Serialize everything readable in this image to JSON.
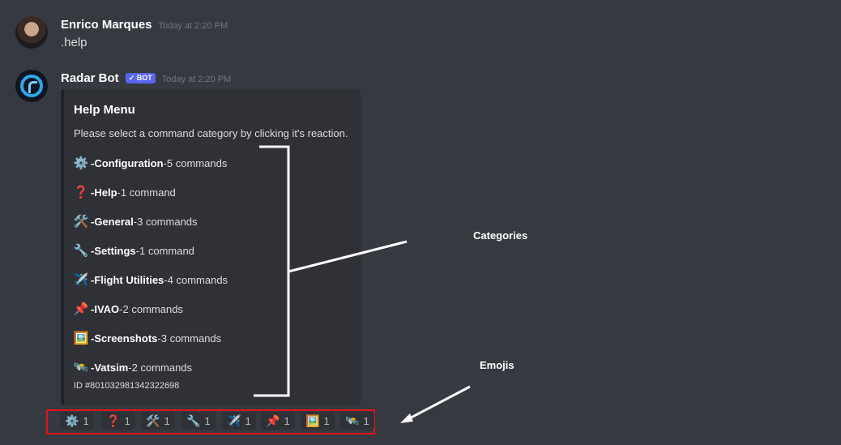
{
  "messages": [
    {
      "username": "Enrico Marques",
      "timestamp": "Today at 2:20 PM",
      "content": ".help"
    },
    {
      "username": "Radar Bot",
      "badge": "✓ BOT",
      "timestamp": "Today at 2:20 PM"
    }
  ],
  "embed": {
    "title": "Help Menu",
    "description": "Please select a command category by clicking it's reaction.",
    "categories": [
      {
        "emoji": "⚙️",
        "icon": "gear-icon",
        "name": "Configuration",
        "count": "5 commands"
      },
      {
        "emoji": "❓",
        "icon": "question-icon",
        "name": "Help",
        "count": "1 command"
      },
      {
        "emoji": "🛠️",
        "icon": "tools-icon",
        "name": "General",
        "count": "3 commands"
      },
      {
        "emoji": "🔧",
        "icon": "wrench-icon",
        "name": "Settings",
        "count": "1 command"
      },
      {
        "emoji": "✈️",
        "icon": "airplane-icon",
        "name": "Flight Utilities",
        "count": "4 commands"
      },
      {
        "emoji": "📌",
        "icon": "pushpin-icon",
        "name": "IVAO",
        "count": "2 commands"
      },
      {
        "emoji": "🖼️",
        "icon": "picture-icon",
        "name": "Screenshots",
        "count": "3 commands"
      },
      {
        "emoji": "🛰️",
        "icon": "satellite-icon",
        "name": "Vatsim",
        "count": "2 commands"
      }
    ],
    "separator": " - ",
    "footer": "ID #801032981342322698"
  },
  "reactions": [
    {
      "emoji": "⚙️",
      "icon": "gear-icon",
      "count": "1"
    },
    {
      "emoji": "❓",
      "icon": "question-icon",
      "count": "1"
    },
    {
      "emoji": "🛠️",
      "icon": "tools-icon",
      "count": "1"
    },
    {
      "emoji": "🔧",
      "icon": "wrench-icon",
      "count": "1"
    },
    {
      "emoji": "✈️",
      "icon": "airplane-icon",
      "count": "1"
    },
    {
      "emoji": "📌",
      "icon": "pushpin-icon",
      "count": "1"
    },
    {
      "emoji": "🖼️",
      "icon": "picture-icon",
      "count": "1"
    },
    {
      "emoji": "🛰️",
      "icon": "satellite-icon",
      "count": "1"
    }
  ],
  "annotations": {
    "categories_label": "Categories",
    "emojis_label": "Emojis",
    "highlight_color": "#e0141b"
  }
}
